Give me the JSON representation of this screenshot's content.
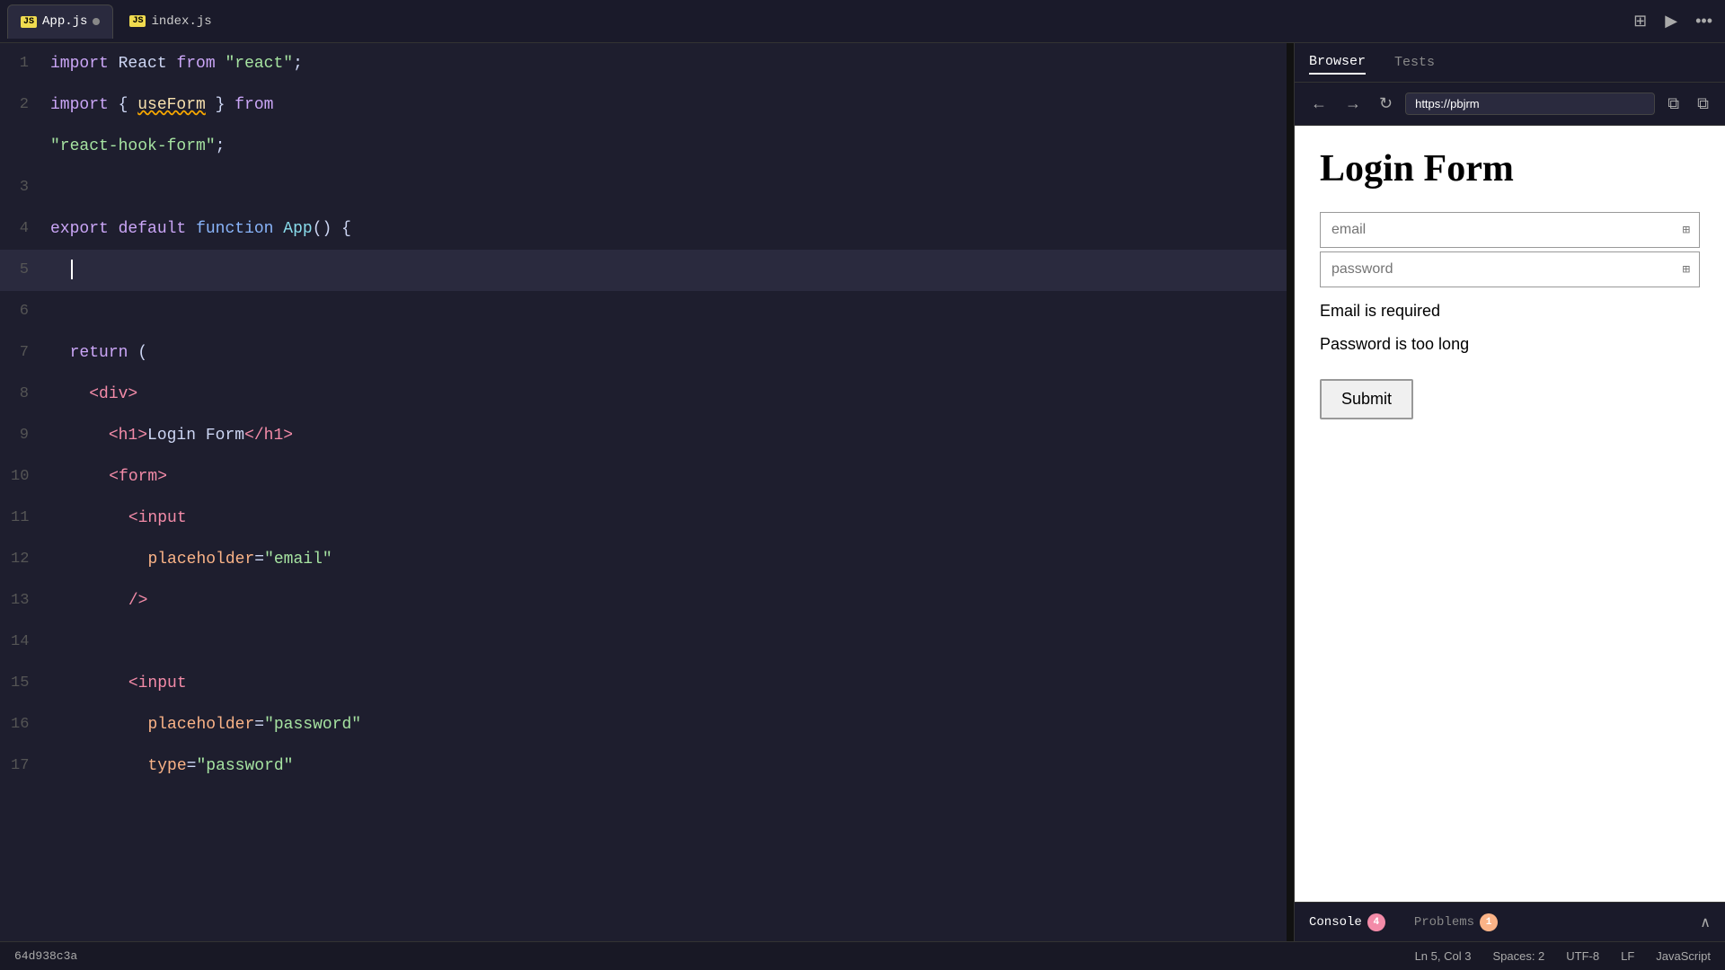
{
  "tabs": [
    {
      "id": "app-js",
      "icon": "JS",
      "label": "App.js",
      "modified": true,
      "active": true
    },
    {
      "id": "index-js",
      "icon": "JS",
      "label": "index.js",
      "modified": false,
      "active": false
    }
  ],
  "toolbar": {
    "layout_icon": "⊞",
    "play_icon": "▶",
    "more_icon": "···"
  },
  "code": {
    "lines": [
      {
        "num": 1,
        "tokens": [
          {
            "t": "kw",
            "v": "import"
          },
          {
            "t": "punc",
            "v": " React "
          },
          {
            "t": "kw",
            "v": "from"
          },
          {
            "t": "punc",
            "v": " "
          },
          {
            "t": "str",
            "v": "\"react\""
          },
          {
            "t": "punc",
            "v": ";"
          }
        ]
      },
      {
        "num": 2,
        "tokens": [
          {
            "t": "kw",
            "v": "import"
          },
          {
            "t": "punc",
            "v": " { "
          },
          {
            "t": "hook",
            "v": "useForm"
          },
          {
            "t": "punc",
            "v": " } "
          },
          {
            "t": "kw",
            "v": "from"
          },
          {
            "t": "punc",
            "v": " "
          },
          {
            "t": "str",
            "v": "\"react-hook-form\""
          },
          {
            "t": "punc",
            "v": ";"
          }
        ],
        "wrap": true,
        "wrap_content": "\"react-hook-form\";"
      },
      {
        "num": 3,
        "tokens": []
      },
      {
        "num": 4,
        "tokens": [
          {
            "t": "kw",
            "v": "export"
          },
          {
            "t": "punc",
            "v": " "
          },
          {
            "t": "kw",
            "v": "default"
          },
          {
            "t": "punc",
            "v": " "
          },
          {
            "t": "kw2",
            "v": "function"
          },
          {
            "t": "punc",
            "v": " "
          },
          {
            "t": "fn-name",
            "v": "App"
          },
          {
            "t": "punc",
            "v": "() {"
          }
        ]
      },
      {
        "num": 5,
        "tokens": [
          {
            "t": "punc",
            "v": "  "
          },
          {
            "t": "cursor",
            "v": ""
          }
        ],
        "active": true
      },
      {
        "num": 6,
        "tokens": []
      },
      {
        "num": 7,
        "tokens": [
          {
            "t": "punc",
            "v": "  "
          },
          {
            "t": "kw",
            "v": "return"
          },
          {
            "t": "punc",
            "v": " ("
          }
        ]
      },
      {
        "num": 8,
        "tokens": [
          {
            "t": "punc",
            "v": "    "
          },
          {
            "t": "tag",
            "v": "<div>"
          }
        ]
      },
      {
        "num": 9,
        "tokens": [
          {
            "t": "punc",
            "v": "      "
          },
          {
            "t": "tag",
            "v": "<h1>"
          },
          {
            "t": "punc",
            "v": "Login Form"
          },
          {
            "t": "tag",
            "v": "</h1>"
          }
        ]
      },
      {
        "num": 10,
        "tokens": [
          {
            "t": "punc",
            "v": "      "
          },
          {
            "t": "tag",
            "v": "<form>"
          }
        ]
      },
      {
        "num": 11,
        "tokens": [
          {
            "t": "punc",
            "v": "        "
          },
          {
            "t": "tag",
            "v": "<input"
          }
        ]
      },
      {
        "num": 12,
        "tokens": [
          {
            "t": "punc",
            "v": "          "
          },
          {
            "t": "attr",
            "v": "placeholder"
          },
          {
            "t": "punc",
            "v": "="
          },
          {
            "t": "val",
            "v": "\"email\""
          }
        ]
      },
      {
        "num": 13,
        "tokens": [
          {
            "t": "punc",
            "v": "        "
          },
          {
            "t": "tag",
            "v": "/>"
          }
        ]
      },
      {
        "num": 14,
        "tokens": []
      },
      {
        "num": 15,
        "tokens": [
          {
            "t": "punc",
            "v": "        "
          },
          {
            "t": "tag",
            "v": "<input"
          }
        ]
      },
      {
        "num": 16,
        "tokens": [
          {
            "t": "punc",
            "v": "          "
          },
          {
            "t": "attr",
            "v": "placeholder"
          },
          {
            "t": "punc",
            "v": "="
          },
          {
            "t": "val",
            "v": "\"password\""
          }
        ]
      },
      {
        "num": 17,
        "tokens": [
          {
            "t": "punc",
            "v": "          "
          },
          {
            "t": "attr",
            "v": "type"
          },
          {
            "t": "punc",
            "v": "="
          },
          {
            "t": "val",
            "v": "\"password\""
          }
        ]
      }
    ]
  },
  "browser": {
    "tab_active": "Browser",
    "tab_inactive": "Tests",
    "url": "https://pbjrm",
    "title": "Login Form",
    "email_placeholder": "email",
    "password_placeholder": "password",
    "error1": "Email is required",
    "error2": "Password is too long",
    "submit_label": "Submit"
  },
  "bottom_tabs": [
    {
      "label": "Console",
      "badge": "4",
      "badge_color": "badge-red",
      "active": true
    },
    {
      "label": "Problems",
      "badge": "1",
      "badge_color": "badge-orange",
      "active": false
    }
  ],
  "status_bar": {
    "git_hash": "64d938c3a",
    "position": "Ln 5, Col 3",
    "spaces": "Spaces: 2",
    "encoding": "UTF-8",
    "line_ending": "LF",
    "language": "JavaScript"
  }
}
